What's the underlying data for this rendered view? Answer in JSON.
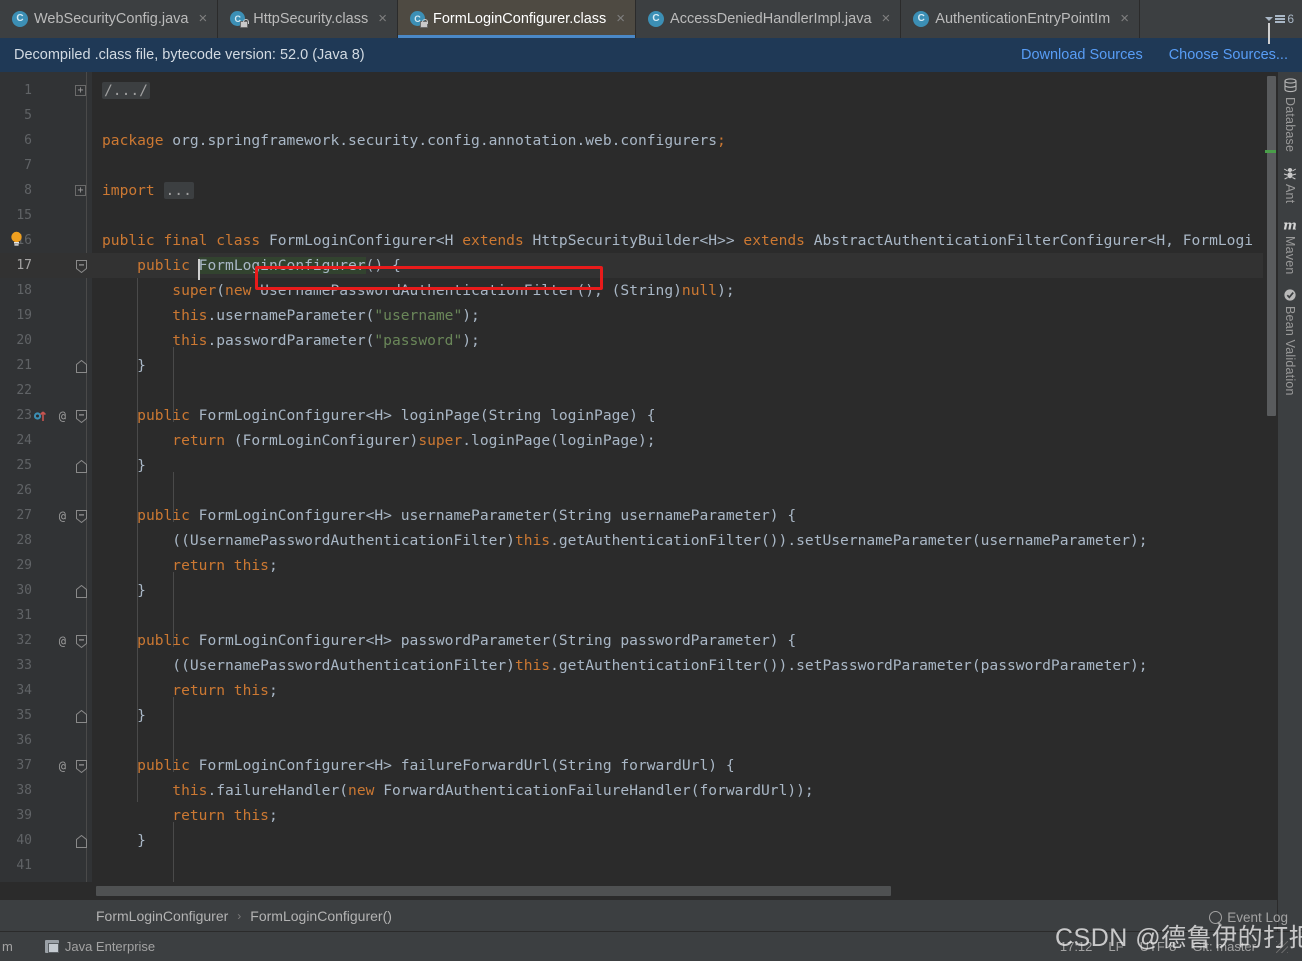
{
  "tabs": [
    {
      "label": "WebSecurityConfig.java",
      "icon": "java-class-icon",
      "active": false,
      "kind": "java"
    },
    {
      "label": "HttpSecurity.class",
      "icon": "java-class-file-icon",
      "active": false,
      "kind": "class"
    },
    {
      "label": "FormLoginConfigurer.class",
      "icon": "java-class-file-icon",
      "active": true,
      "kind": "class"
    },
    {
      "label": "AccessDeniedHandlerImpl.java",
      "icon": "java-class-icon",
      "active": false,
      "kind": "java"
    },
    {
      "label": "AuthenticationEntryPointIm",
      "icon": "java-class-icon",
      "active": false,
      "kind": "java"
    }
  ],
  "tab_overflow": {
    "count": "6",
    "icon": "chevron-down-list-icon"
  },
  "tab_close_glyph": "×",
  "banner": {
    "message": "Decompiled .class file, bytecode version: 52.0 (Java 8)",
    "download_sources": "Download Sources",
    "choose_sources": "Choose Sources..."
  },
  "editor": {
    "current_line": 17,
    "line_numbers": [
      "1",
      "5",
      "6",
      "7",
      "8",
      "15",
      "16",
      "17",
      "18",
      "19",
      "20",
      "21",
      "22",
      "23",
      "24",
      "25",
      "26",
      "27",
      "28",
      "29",
      "30",
      "31",
      "32",
      "33",
      "34",
      "35",
      "36",
      "37",
      "38",
      "39",
      "40",
      "41"
    ],
    "lines": [
      {
        "n": "1",
        "text": "/.../",
        "fold": "expand"
      },
      {
        "n": "5",
        "text": ""
      },
      {
        "n": "6",
        "text": "package org.springframework.security.config.annotation.web.configurers;"
      },
      {
        "n": "7",
        "text": ""
      },
      {
        "n": "8",
        "text": "import ...",
        "fold": "expand"
      },
      {
        "n": "15",
        "text": ""
      },
      {
        "n": "16",
        "text": "public final class FormLoginConfigurer<H extends HttpSecurityBuilder<H>> extends AbstractAuthenticationFilterConfigurer<H, FormLogi",
        "bulb": true
      },
      {
        "n": "17",
        "text": "    public FormLoginConfigurer() {",
        "fold": "collapse",
        "current": true
      },
      {
        "n": "18",
        "text": "        super(new UsernamePasswordAuthenticationFilter(), (String)null);"
      },
      {
        "n": "19",
        "text": "        this.usernameParameter(\"username\");"
      },
      {
        "n": "20",
        "text": "        this.passwordParameter(\"password\");"
      },
      {
        "n": "21",
        "text": "    }",
        "fold": "end"
      },
      {
        "n": "22",
        "text": ""
      },
      {
        "n": "23",
        "text": "    public FormLoginConfigurer<H> loginPage(String loginPage) {",
        "fold": "collapse",
        "at": true,
        "override": true
      },
      {
        "n": "24",
        "text": "        return (FormLoginConfigurer)super.loginPage(loginPage);"
      },
      {
        "n": "25",
        "text": "    }",
        "fold": "end"
      },
      {
        "n": "26",
        "text": ""
      },
      {
        "n": "27",
        "text": "    public FormLoginConfigurer<H> usernameParameter(String usernameParameter) {",
        "fold": "collapse",
        "at": true
      },
      {
        "n": "28",
        "text": "        ((UsernamePasswordAuthenticationFilter)this.getAuthenticationFilter()).setUsernameParameter(usernameParameter);"
      },
      {
        "n": "29",
        "text": "        return this;"
      },
      {
        "n": "30",
        "text": "    }",
        "fold": "end"
      },
      {
        "n": "31",
        "text": ""
      },
      {
        "n": "32",
        "text": "    public FormLoginConfigurer<H> passwordParameter(String passwordParameter) {",
        "fold": "collapse",
        "at": true
      },
      {
        "n": "33",
        "text": "        ((UsernamePasswordAuthenticationFilter)this.getAuthenticationFilter()).setPasswordParameter(passwordParameter);"
      },
      {
        "n": "34",
        "text": "        return this;"
      },
      {
        "n": "35",
        "text": "    }",
        "fold": "end"
      },
      {
        "n": "36",
        "text": ""
      },
      {
        "n": "37",
        "text": "    public FormLoginConfigurer<H> failureForwardUrl(String forwardUrl) {",
        "fold": "collapse",
        "at": true
      },
      {
        "n": "38",
        "text": "        this.failureHandler(new ForwardAuthenticationFailureHandler(forwardUrl));"
      },
      {
        "n": "39",
        "text": "        return this;"
      },
      {
        "n": "40",
        "text": "    }",
        "fold": "end"
      },
      {
        "n": "41",
        "text": ""
      }
    ],
    "annotation": {
      "type": "red-rectangle",
      "target": "UsernamePasswordAuthenticationFilter()",
      "color": "#e81b1b"
    }
  },
  "breadcrumb": {
    "items": [
      "FormLoginConfigurer",
      "FormLoginConfigurer()"
    ],
    "separator": "›"
  },
  "right_tool_windows": [
    {
      "label": "Database",
      "icon": "database-icon"
    },
    {
      "label": "Ant",
      "icon": "ant-icon"
    },
    {
      "label": "Maven",
      "icon": "maven-m-icon"
    },
    {
      "label": "Bean Validation",
      "icon": "bean-validation-icon"
    }
  ],
  "statusbar": {
    "terminal_label": "m",
    "java_enterprise": "Java Enterprise",
    "event_log": "Event Log",
    "time": "17:12",
    "line_sep": "LF",
    "encoding": "UTF-8",
    "vcs": "Git: master"
  },
  "watermark": "CSDN @德鲁伊的打把子",
  "colors": {
    "accent_blue": "#4a88c7",
    "link_blue": "#589df6",
    "banner_bg": "#1f3956",
    "editor_bg": "#2b2b2b",
    "gutter_bg": "#313335",
    "chrome_bg": "#3c3f41",
    "keyword_orange": "#cc7832",
    "string_green": "#6a8759",
    "text_grey": "#a9b7c6",
    "annotation_red": "#e81b1b",
    "active_tab_bg": "#4e4a42",
    "marker_green": "#4a9e4a"
  }
}
